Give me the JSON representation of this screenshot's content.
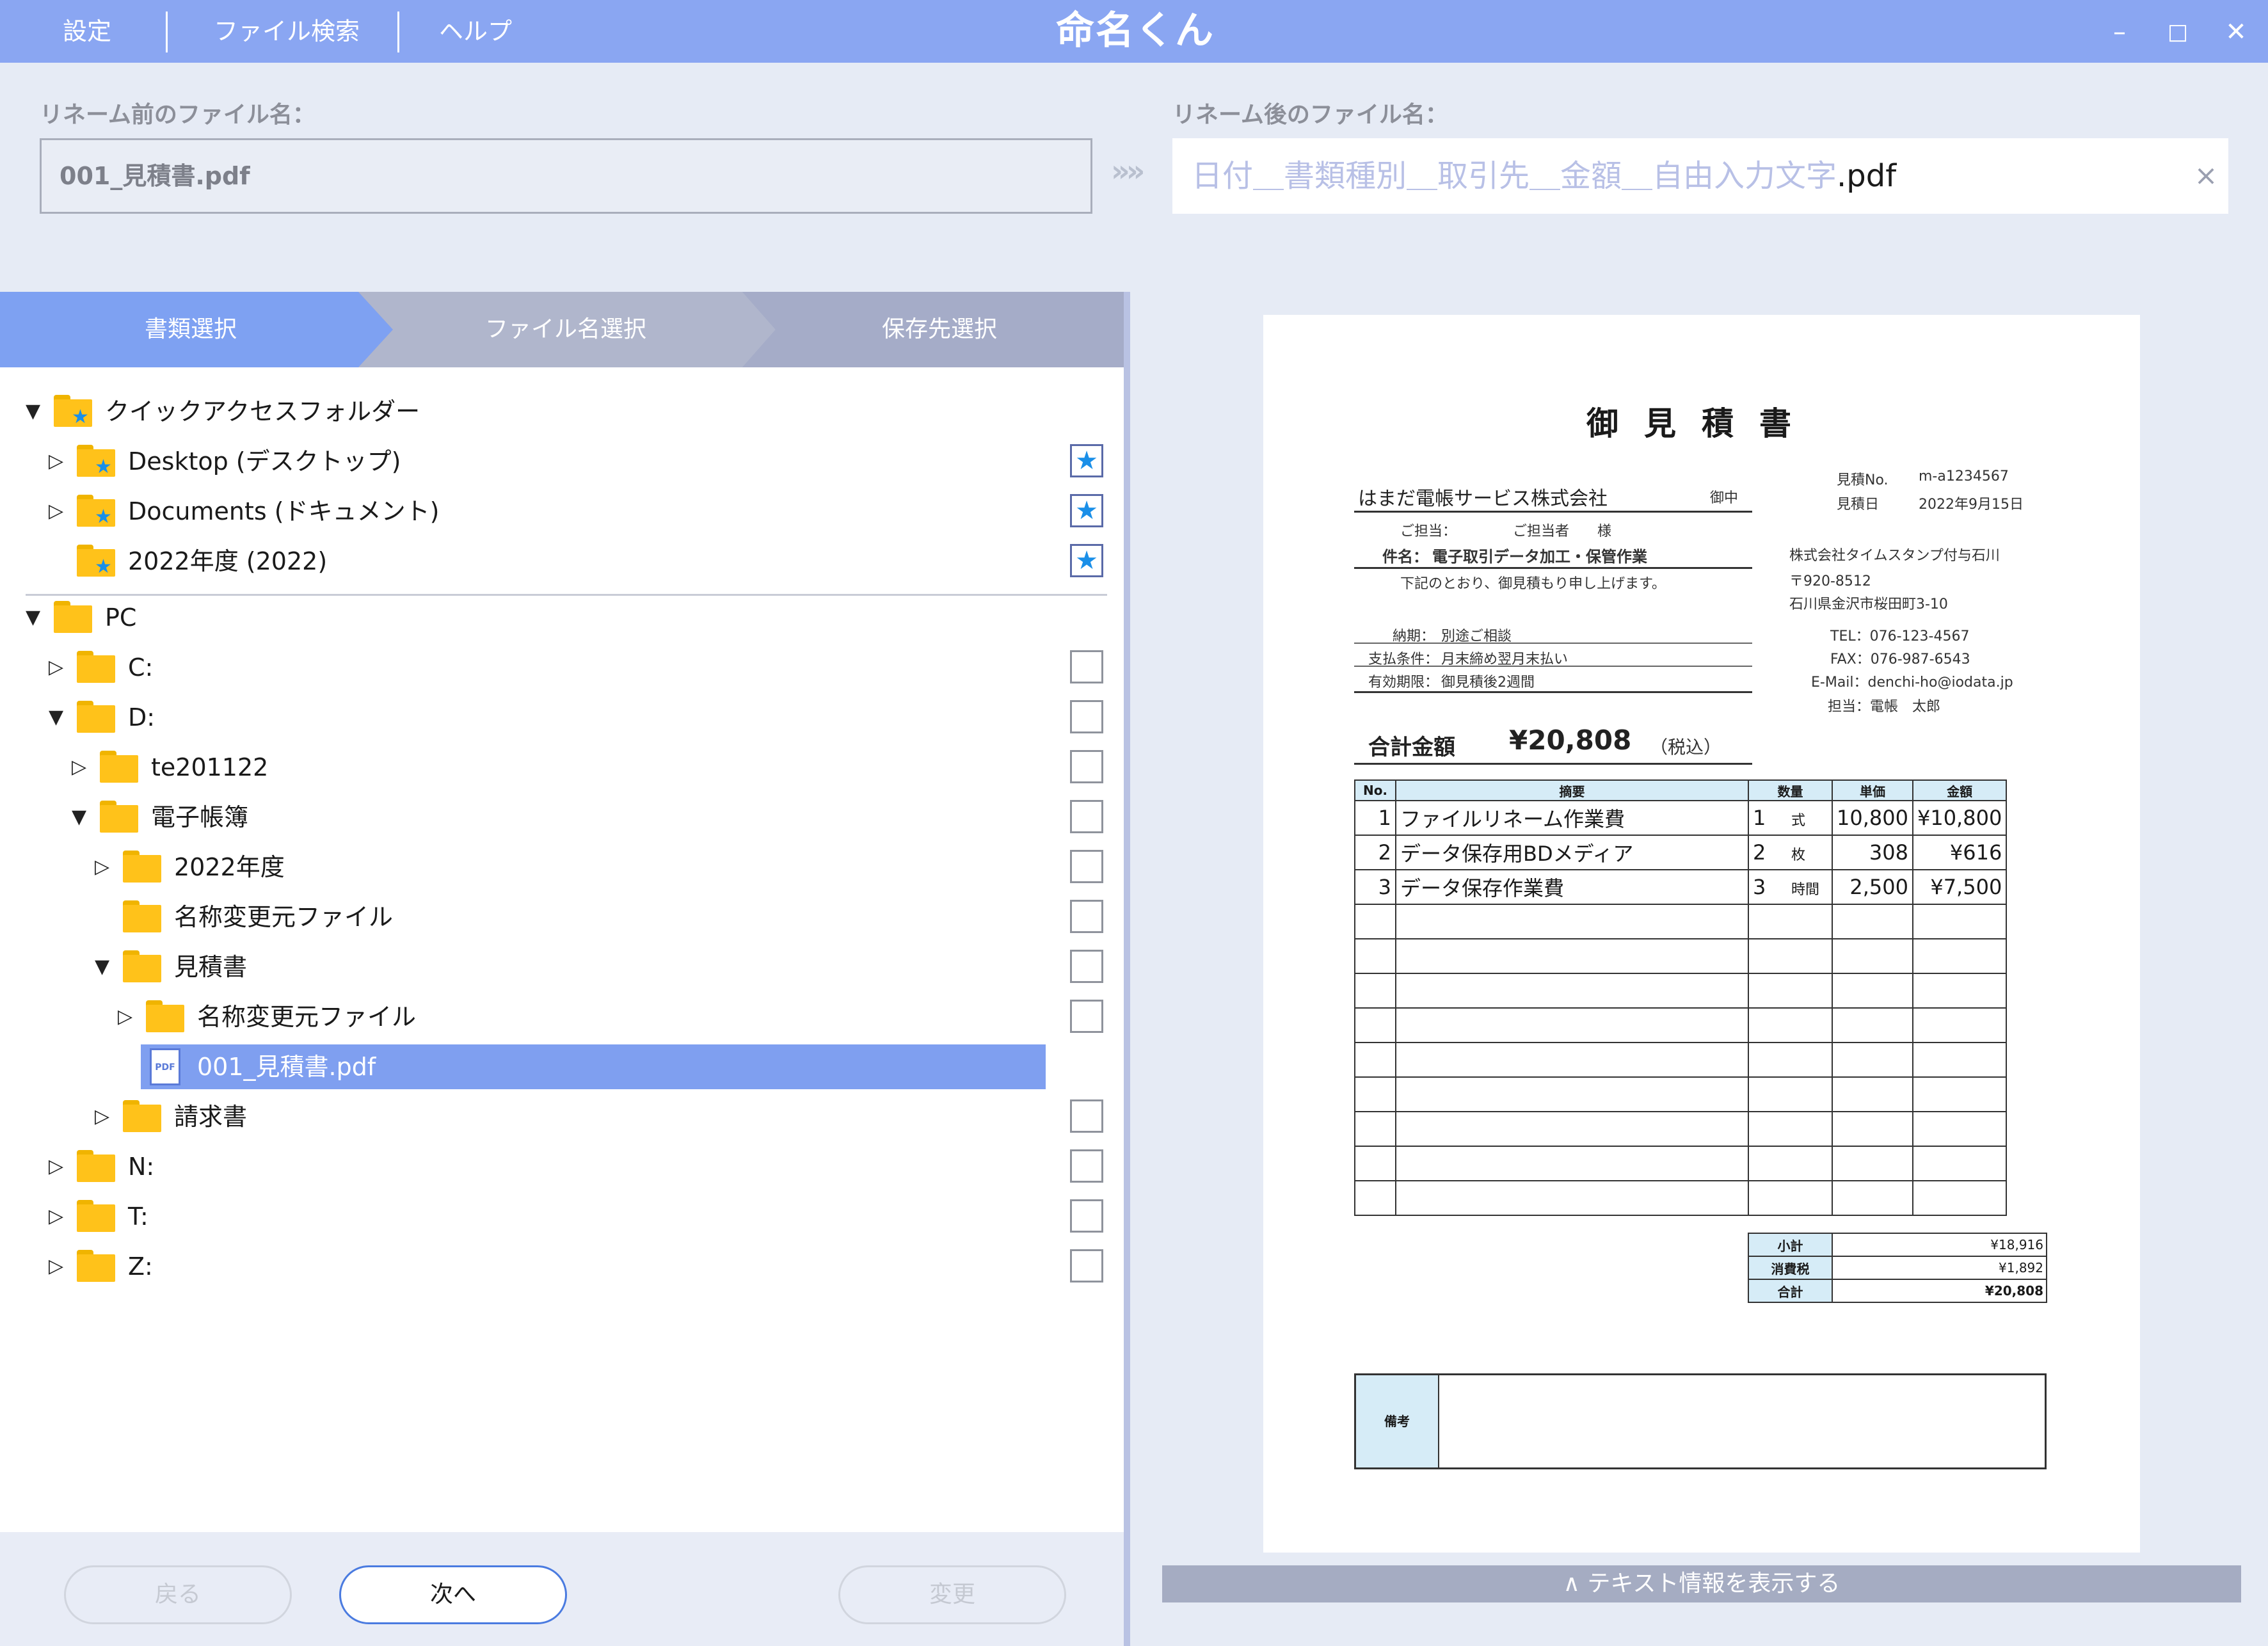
{
  "menu": {
    "settings": "設定",
    "file_search": "ファイル検索",
    "help": "ヘルプ"
  },
  "app_title": "命名くん",
  "window": {
    "minimize": "–",
    "maximize": "□",
    "close": "✕"
  },
  "rename": {
    "before_label": "リネーム前のファイル名：",
    "before_value": "001_見積書.pdf",
    "arrow": "»»",
    "after_label": "リネーム後のファイル名：",
    "after_placeholder": "日付＿書類種別＿取引先＿金額＿自由入力文字",
    "after_ext": ".pdf",
    "clear": "×"
  },
  "steps": [
    "書類選択",
    "ファイル名選択",
    "保存先選択"
  ],
  "tree": {
    "quick_access": {
      "label": "クイックアクセスフォルダー",
      "items": [
        "Desktop (デスクトップ)",
        "Documents (ドキュメント)",
        "2022年度 (2022)"
      ]
    },
    "pc": {
      "label": "PC",
      "drive_c": "C:",
      "drive_d": "D:",
      "te201122": "te201122",
      "denshi": "電子帳簿",
      "fy2022": "2022年度",
      "meisho1": "名称変更元ファイル",
      "mitsumori": "見積書",
      "meisho2": "名称変更元ファイル",
      "pdf_file": "001_見積書.pdf",
      "seikyu": "請求書",
      "drive_n": "N:",
      "drive_t": "T:",
      "drive_z": "Z:"
    }
  },
  "buttons": {
    "back": "戻る",
    "next": "次へ",
    "change": "変更"
  },
  "preview": {
    "toggle": "∧ テキスト情報を表示する",
    "doc": {
      "title": "御見積書",
      "client": "はまだ電帳サービス株式会社",
      "onchu": "御中",
      "tanto_label": "ご担当：",
      "tanto_value": "ご担当者　　様",
      "no_label": "見積No.",
      "no_value": "m-a1234567",
      "date_label": "見積日",
      "date_value": "2022年9月15日",
      "subject_label": "件名：",
      "subject_value": "電子取引データ加工・保管作業",
      "greeting": "下記のとおり、御見積もり申し上げます。",
      "company": "株式会社タイムスタンプ付与石川",
      "zip": "〒920-8512",
      "address": "石川県金沢市桜田町3-10",
      "tel": "TEL：076-123-4567",
      "fax": "FAX：076-987-6543",
      "email": "E-Mail：denchi-ho@iodata.jp",
      "person": "担当：電帳　太郎",
      "delivery_label": "納期：",
      "delivery_value": "別途ご相談",
      "payment_label": "支払条件：",
      "payment_value": "月末締め翌月末払い",
      "valid_label": "有効期限：",
      "valid_value": "御見積後2週間",
      "total_label": "合計金額",
      "total_value": "¥20,808",
      "tax_note": "（税込）",
      "headers": [
        "No.",
        "摘要",
        "数量",
        "単価",
        "金額"
      ],
      "rows": [
        {
          "no": "1",
          "desc": "ファイルリネーム作業費",
          "qty": "1",
          "unit": "式",
          "price": "10,800",
          "amount": "¥10,800"
        },
        {
          "no": "2",
          "desc": "データ保存用BDメディア",
          "qty": "2",
          "unit": "枚",
          "price": "308",
          "amount": "¥616"
        },
        {
          "no": "3",
          "desc": "データ保存作業費",
          "qty": "3",
          "unit": "時間",
          "price": "2,500",
          "amount": "¥7,500"
        }
      ],
      "subtotal_label": "小計",
      "subtotal": "¥18,916",
      "tax_label": "消費税",
      "tax": "¥1,892",
      "grand_label": "合計",
      "grand": "¥20,808",
      "remarks_label": "備考"
    }
  },
  "colors": {
    "accent": "#8aa6f2",
    "selection": "#7f9ff0",
    "folder": "#ffc21a",
    "star": "#1a8fe8",
    "table_header": "#d6ecf7"
  }
}
